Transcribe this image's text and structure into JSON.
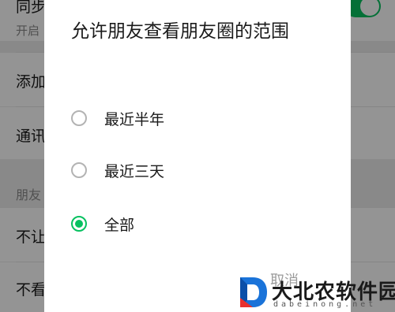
{
  "background": {
    "rows": [
      {
        "text": "同步",
        "type": "row"
      },
      {
        "text": "开启",
        "type": "subtext"
      },
      {
        "text": "添加",
        "type": "row"
      },
      {
        "text": "通讯",
        "type": "row"
      },
      {
        "text": "朋友",
        "type": "section"
      },
      {
        "text": "不让",
        "type": "row"
      },
      {
        "text": "不看",
        "type": "row"
      }
    ]
  },
  "dialog": {
    "title": "允许朋友查看朋友圈的范围",
    "options": [
      {
        "label": "最近半年",
        "checked": false
      },
      {
        "label": "最近三天",
        "checked": false
      },
      {
        "label": "全部",
        "checked": true
      }
    ],
    "cancel_label": "取消"
  },
  "watermark": {
    "text": "大北农软件园",
    "sub": "dabeinong.net"
  },
  "colors": {
    "accent": "#07c160",
    "overlay": "rgba(0,0,0,0.42)"
  }
}
